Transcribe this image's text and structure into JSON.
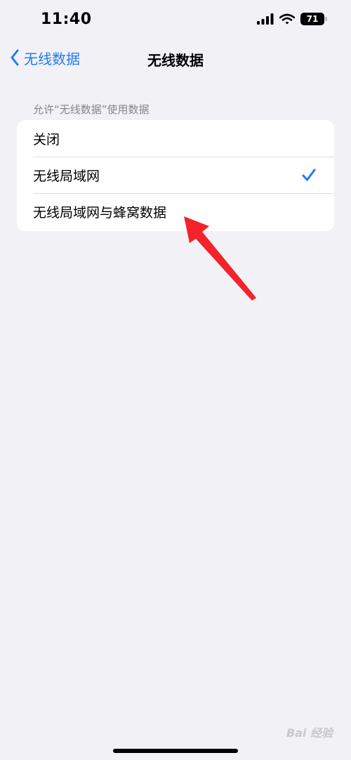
{
  "status_bar": {
    "time": "11:40",
    "battery_level": "71",
    "icons": [
      "cellular-signal-icon",
      "wifi-icon",
      "battery-icon"
    ]
  },
  "nav": {
    "back_label": "无线数据",
    "title": "无线数据"
  },
  "section": {
    "header": "允许“无线数据”使用数据",
    "options": [
      {
        "label": "关闭",
        "selected": false
      },
      {
        "label": "无线局域网",
        "selected": true
      },
      {
        "label": "无线局域网与蜂窝数据",
        "selected": false
      }
    ]
  },
  "watermark": "Bai 经验",
  "colors": {
    "background": "#f2f1f6",
    "accent": "#1f7cf5",
    "annotation_arrow": "#f2232a"
  }
}
